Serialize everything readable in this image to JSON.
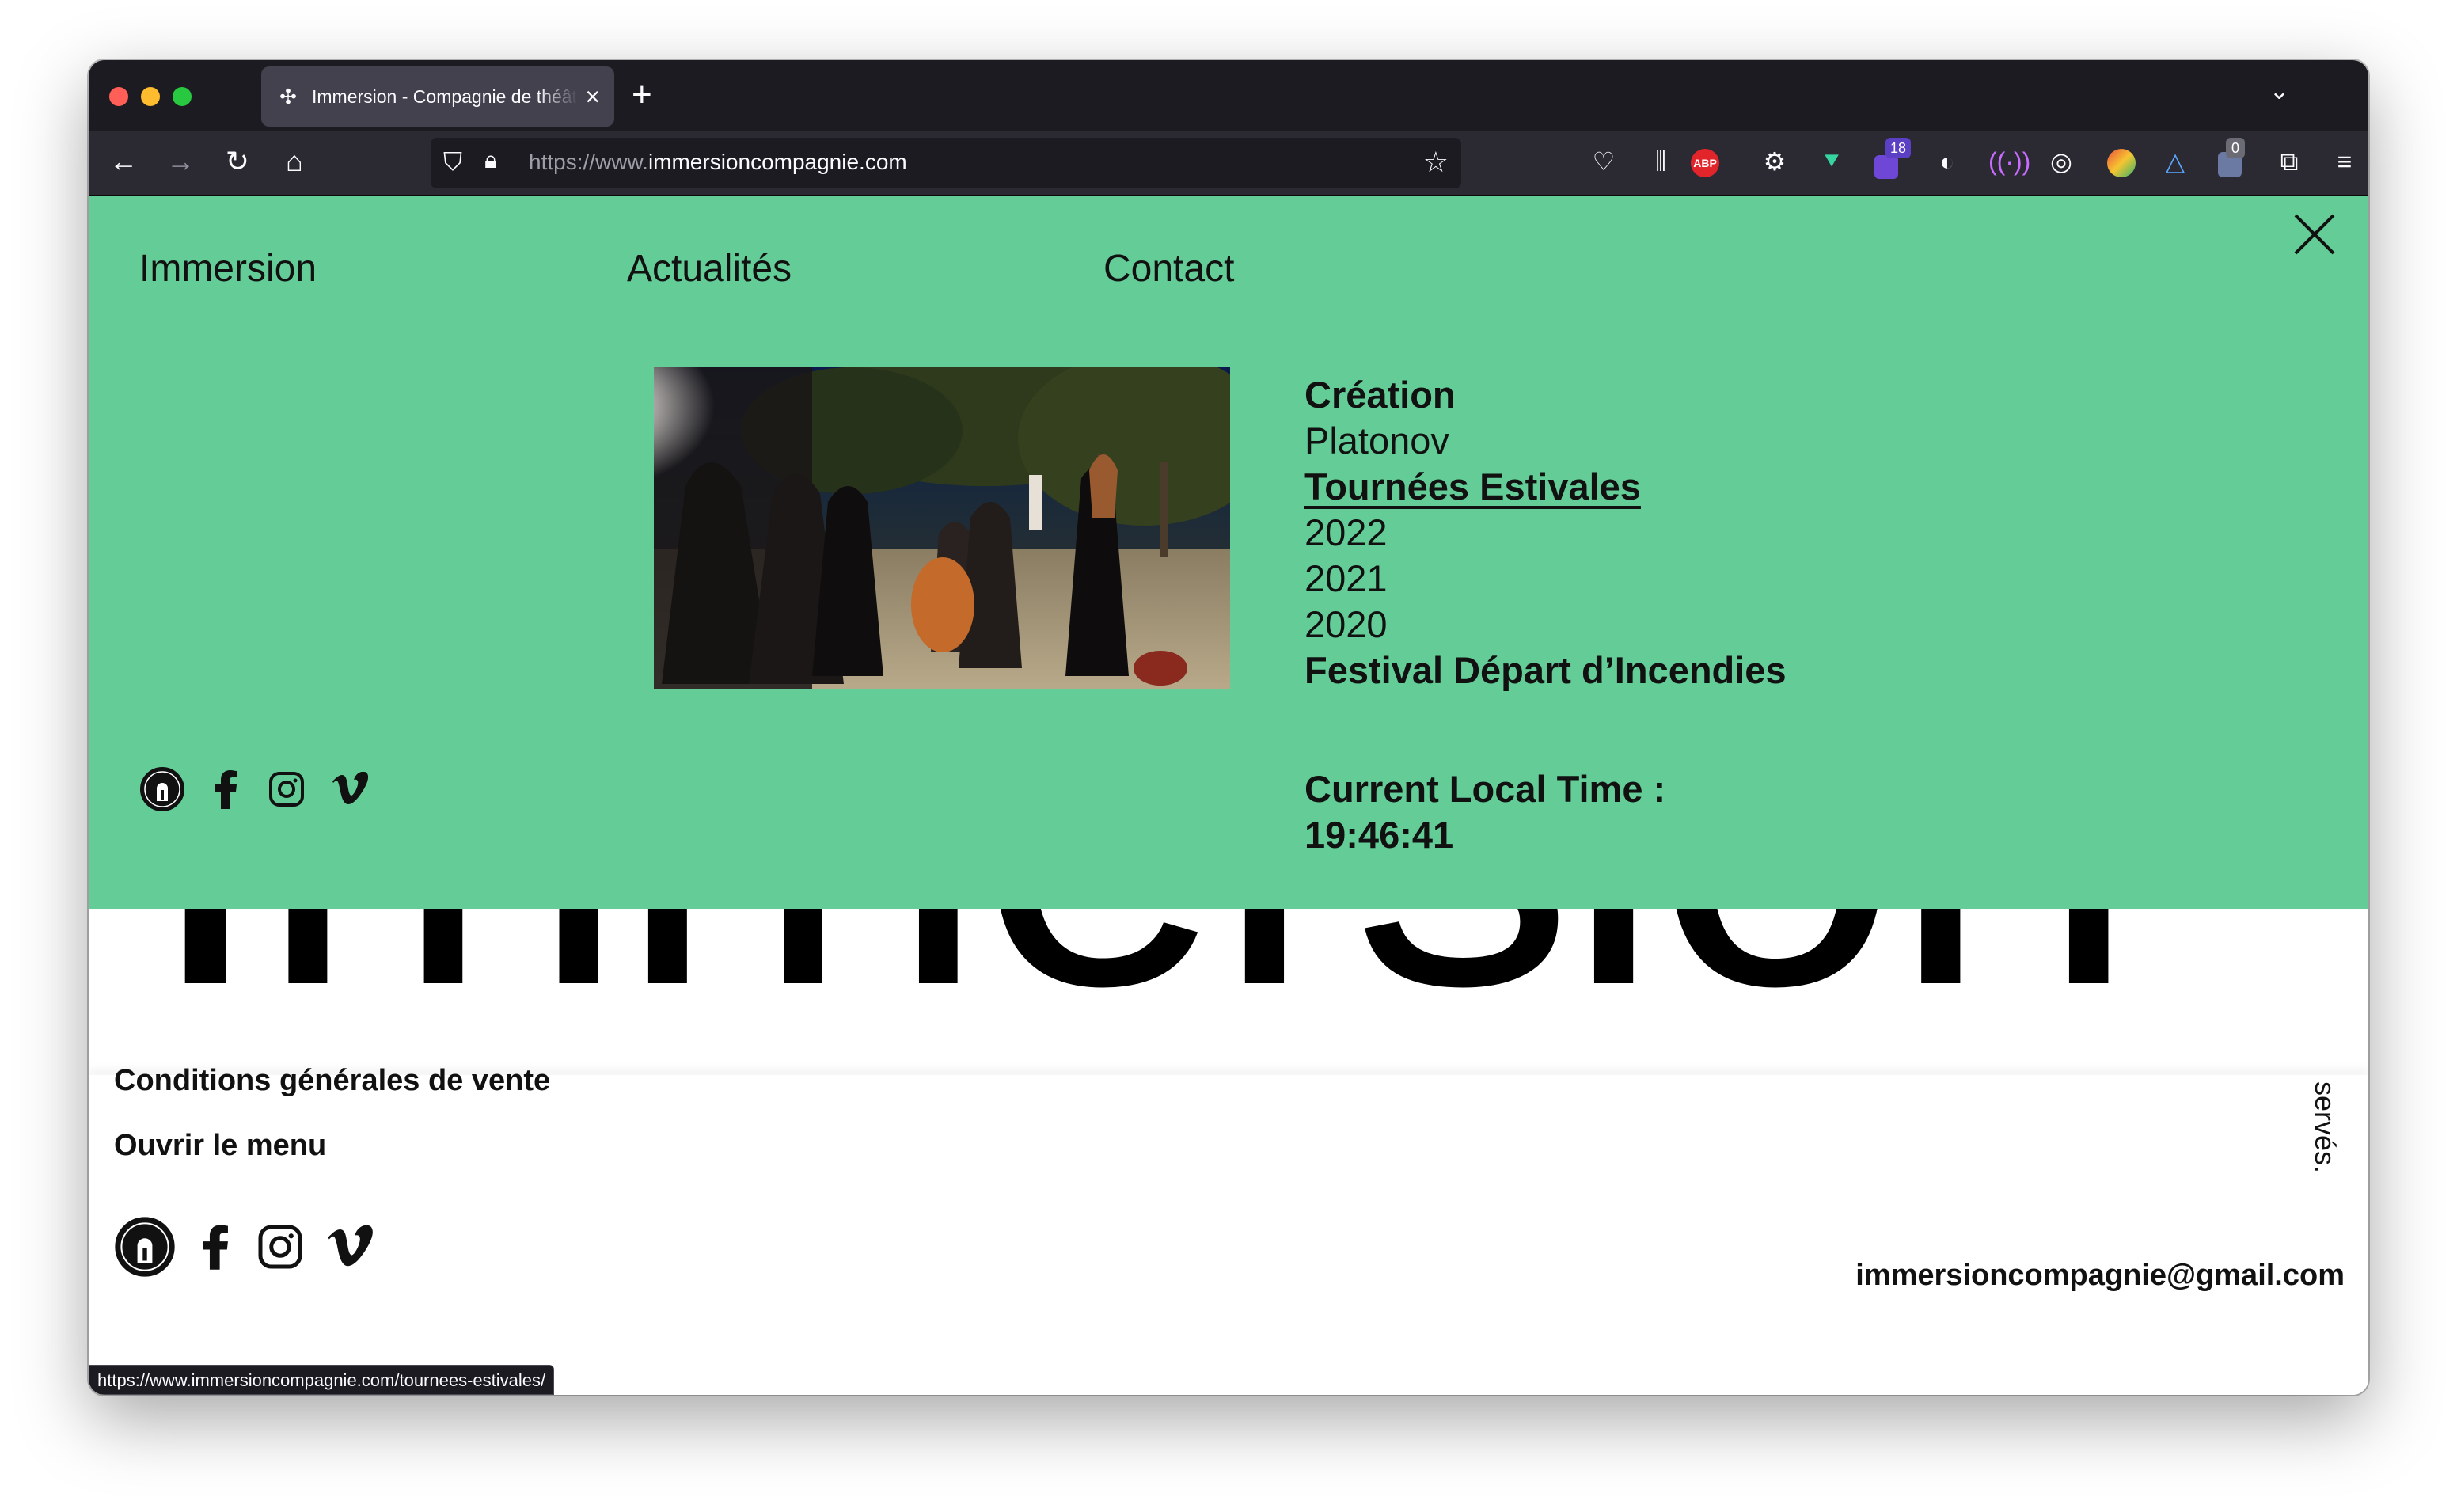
{
  "browser": {
    "tab_title": "Immersion - Compagnie de théâtre",
    "tab_close": "×",
    "new_tab": "+",
    "tab_list": "⌄",
    "url_prefix": "https://www.",
    "url_domain": "immersioncompagnie.com",
    "extension_badges": {
      "count_a": "18",
      "count_b": "0"
    },
    "extensions": {
      "abp": "ABP"
    }
  },
  "menu": {
    "links": [
      "Immersion",
      "Actualités",
      "Contact"
    ],
    "submenu": [
      {
        "label": "Création",
        "bold": true,
        "underline": false
      },
      {
        "label": "Platonov",
        "bold": false,
        "underline": false
      },
      {
        "label": "Tournées Estivales",
        "bold": true,
        "underline": true
      },
      {
        "label": "2022",
        "bold": false,
        "underline": false
      },
      {
        "label": "2021",
        "bold": false,
        "underline": false
      },
      {
        "label": "2020",
        "bold": false,
        "underline": false
      },
      {
        "label": "Festival Départ d’Incendies",
        "bold": true,
        "underline": false
      }
    ],
    "time_label": "Current Local Time :",
    "time_value": "19:46:41",
    "accent_color": "#64cd97"
  },
  "page": {
    "wordmark": "Immersion",
    "footer_cgv": "Conditions générales de vente",
    "footer_open_menu": "Ouvrir le menu",
    "footer_email": "immersioncompagnie@gmail.com",
    "footer_vertical": "servés."
  },
  "status_bar": {
    "url": "https://www.immersioncompagnie.com/tournees-estivales/"
  }
}
